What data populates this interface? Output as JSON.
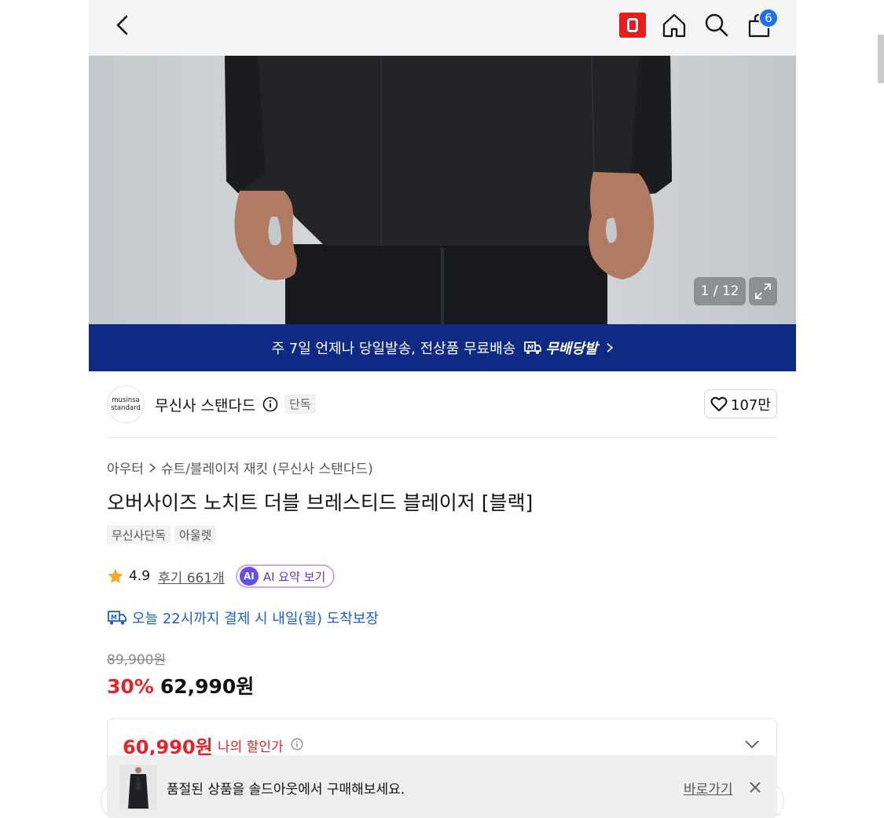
{
  "header": {
    "cart_count": "6",
    "icons": [
      "back-icon",
      "musinsa-logo-icon",
      "home-icon",
      "search-icon",
      "shopping-bag-icon"
    ],
    "logo_color": "#e41d1d",
    "badge_color": "#1f6ff2"
  },
  "gallery": {
    "counter": "1 / 12"
  },
  "banner": {
    "text": "주 7일 언제나 당일발송, 전상품 무료배송",
    "brand": "무배당발",
    "bg_color": "#0e2a84"
  },
  "brand": {
    "logo_line1": "musinsa",
    "logo_line2": "standard",
    "name": "무신사 스탠다드",
    "tag": "단독",
    "likes": "107만"
  },
  "product": {
    "breadcrumb": [
      "아우터",
      "슈트/블레이저 재킷 (무신사 스탠다드)"
    ],
    "title": "오버사이즈 노치트 더블 브레스티드 블레이저 [블랙]",
    "tags": [
      "무신사단독",
      "아울렛"
    ],
    "rating": "4.9",
    "reviews": "후기 661개",
    "ai_badge": "AI",
    "ai_label": "AI 요약 보기",
    "arrival": "오늘 22시까지 결제 시 내일(월) 도착보장"
  },
  "price": {
    "original": "89,900원",
    "discount": "30%",
    "sale": "62,990원",
    "my_price": "60,990원",
    "my_label": "나의 할인가",
    "accent_color": "#e3242b"
  },
  "toast": {
    "message": "품절된 상품을 솔드아웃에서 구매해보세요.",
    "link": "바로가기"
  }
}
